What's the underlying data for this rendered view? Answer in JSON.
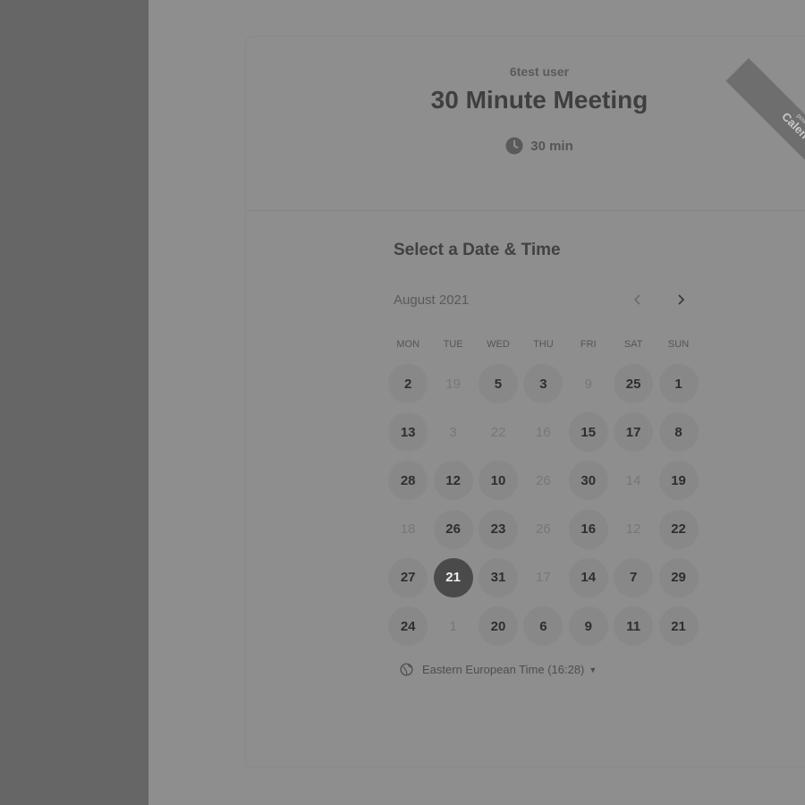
{
  "header": {
    "host_name": "6test user",
    "event_title": "30 Minute Meeting",
    "duration": "30 min",
    "ribbon_line1": "pow",
    "ribbon_line2": "Calen"
  },
  "calendar": {
    "section_title": "Select a Date & Time",
    "month_label": "August 2021",
    "weekdays": [
      "MON",
      "TUE",
      "WED",
      "THU",
      "FRI",
      "SAT",
      "SUN"
    ],
    "days": [
      {
        "label": "2",
        "state": "available"
      },
      {
        "label": "19",
        "state": "unavailable"
      },
      {
        "label": "5",
        "state": "available"
      },
      {
        "label": "3",
        "state": "available"
      },
      {
        "label": "9",
        "state": "unavailable"
      },
      {
        "label": "25",
        "state": "available"
      },
      {
        "label": "1",
        "state": "available"
      },
      {
        "label": "13",
        "state": "available"
      },
      {
        "label": "3",
        "state": "unavailable"
      },
      {
        "label": "22",
        "state": "unavailable"
      },
      {
        "label": "16",
        "state": "unavailable"
      },
      {
        "label": "15",
        "state": "available"
      },
      {
        "label": "17",
        "state": "available"
      },
      {
        "label": "8",
        "state": "available"
      },
      {
        "label": "28",
        "state": "available"
      },
      {
        "label": "12",
        "state": "available"
      },
      {
        "label": "10",
        "state": "available"
      },
      {
        "label": "26",
        "state": "unavailable"
      },
      {
        "label": "30",
        "state": "available"
      },
      {
        "label": "14",
        "state": "unavailable"
      },
      {
        "label": "19",
        "state": "available"
      },
      {
        "label": "18",
        "state": "unavailable"
      },
      {
        "label": "26",
        "state": "available"
      },
      {
        "label": "23",
        "state": "available"
      },
      {
        "label": "26",
        "state": "unavailable"
      },
      {
        "label": "16",
        "state": "available"
      },
      {
        "label": "12",
        "state": "unavailable"
      },
      {
        "label": "22",
        "state": "available"
      },
      {
        "label": "27",
        "state": "available"
      },
      {
        "label": "21",
        "state": "selected"
      },
      {
        "label": "31",
        "state": "available"
      },
      {
        "label": "17",
        "state": "unavailable"
      },
      {
        "label": "14",
        "state": "available"
      },
      {
        "label": "7",
        "state": "available"
      },
      {
        "label": "29",
        "state": "available"
      },
      {
        "label": "24",
        "state": "available"
      },
      {
        "label": "1",
        "state": "unavailable"
      },
      {
        "label": "20",
        "state": "available"
      },
      {
        "label": "6",
        "state": "available"
      },
      {
        "label": "9",
        "state": "available"
      },
      {
        "label": "11",
        "state": "available"
      },
      {
        "label": "21",
        "state": "available"
      }
    ]
  },
  "timezone": {
    "label": "Eastern European Time (16:28)"
  },
  "icons": {
    "clock": "clock-icon",
    "prev": "chevron-left-icon",
    "next": "chevron-right-icon",
    "globe": "globe-icon",
    "caret": "caret-down-icon"
  },
  "colors": {
    "selected_day": "#4a4a4a",
    "available_day": "#888888",
    "overlay_page": "#8e8e8e",
    "left_panel": "#666666"
  }
}
